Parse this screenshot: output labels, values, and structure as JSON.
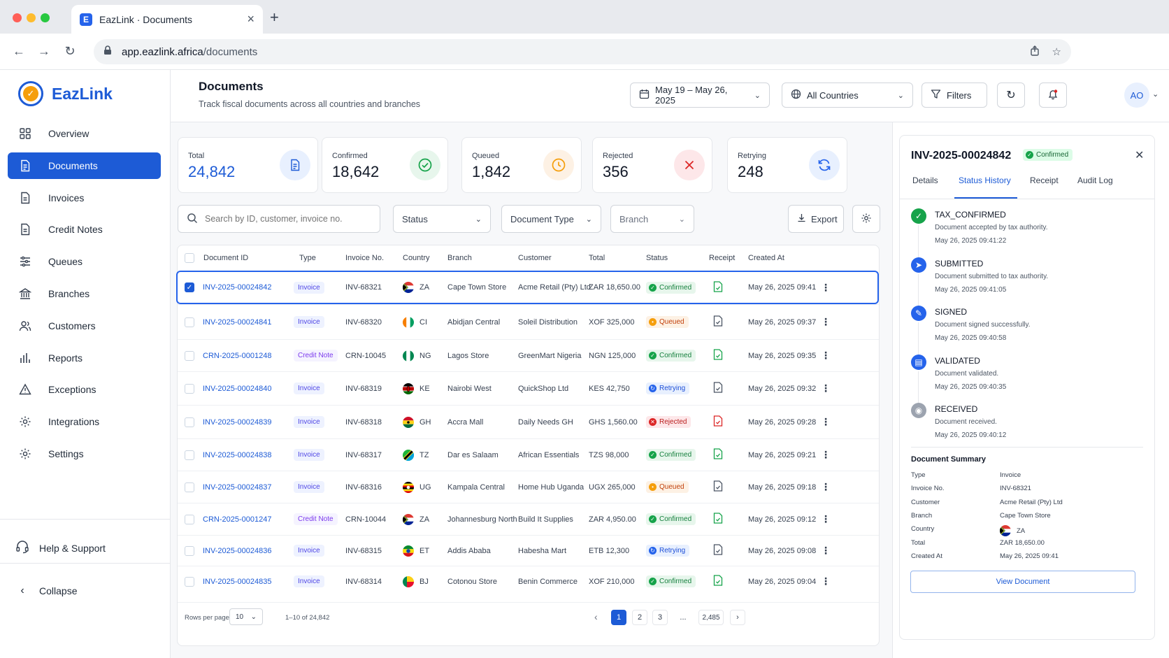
{
  "browser": {
    "tab_title": "EazLink · Documents",
    "favicon_letter": "E",
    "url_host": "app.eazlink.africa",
    "url_path": "/documents"
  },
  "brand": {
    "name": "EazLink",
    "accent": "#1d5bd6",
    "logo_color": "#f59e0b"
  },
  "sidebar": {
    "items": [
      {
        "label": "Overview",
        "icon": "grid-icon",
        "active": false
      },
      {
        "label": "Documents",
        "icon": "document-icon",
        "active": true
      },
      {
        "label": "Invoices",
        "icon": "invoice-icon",
        "active": false
      },
      {
        "label": "Credit Notes",
        "icon": "credit-note-icon",
        "active": false
      },
      {
        "label": "Queues",
        "icon": "queues-icon",
        "active": false
      },
      {
        "label": "Branches",
        "icon": "bank-icon",
        "active": false
      },
      {
        "label": "Customers",
        "icon": "users-icon",
        "active": false
      },
      {
        "label": "Reports",
        "icon": "bar-chart-icon",
        "active": false
      },
      {
        "label": "Exceptions",
        "icon": "warning-icon",
        "active": false
      },
      {
        "label": "Integrations",
        "icon": "integrations-gear-icon",
        "active": false
      },
      {
        "label": "Settings",
        "icon": "gear-icon",
        "active": false
      }
    ],
    "help_label": "Help & Support",
    "collapse_label": "Collapse"
  },
  "header": {
    "title": "Documents",
    "subtitle": "Track fiscal documents across all countries and branches",
    "date_range": "May 19 – May 26, 2025",
    "countries": "All Countries",
    "filters_label": "Filters",
    "avatar": "AO"
  },
  "stats": [
    {
      "label": "Total",
      "value": "24,842",
      "color": "#1d5bd6",
      "icon": "document-icon",
      "icon_bg": "#e8f0fe"
    },
    {
      "label": "Confirmed",
      "value": "18,642",
      "color": "#111827",
      "icon": "check-circle-icon",
      "icon_bg": "#e7f6ec"
    },
    {
      "label": "Queued",
      "value": "1,842",
      "color": "#111827",
      "icon": "clock-icon",
      "icon_bg": "#fdf1e4"
    },
    {
      "label": "Rejected",
      "value": "356",
      "color": "#111827",
      "icon": "x-icon",
      "icon_bg": "#fde7e9"
    },
    {
      "label": "Retrying",
      "value": "248",
      "color": "#111827",
      "icon": "refresh-icon",
      "icon_bg": "#e8f0fe"
    }
  ],
  "filters": {
    "search_placeholder": "Search by ID, customer, invoice no.",
    "status": "Status",
    "document_type": "Document Type",
    "branch": "Branch",
    "export": "Export"
  },
  "table": {
    "columns": [
      "Document ID",
      "Type",
      "Invoice No.",
      "Country",
      "Branch",
      "Customer",
      "Total",
      "Status",
      "Receipt",
      "Created At"
    ],
    "rows": [
      {
        "id": "INV-2025-00024842",
        "type": "Invoice",
        "invoice": "INV-68321",
        "country": "ZA",
        "branch": "Cape Town Store",
        "customer": "Acme Retail (Pty) Ltd",
        "total": "ZAR 18,650.00",
        "status": "Confirmed",
        "created": "May 26, 2025 09:41",
        "selected": true
      },
      {
        "id": "INV-2025-00024841",
        "type": "Invoice",
        "invoice": "INV-68320",
        "country": "CI",
        "branch": "Abidjan Central",
        "customer": "Soleil Distribution",
        "total": "XOF 325,000",
        "status": "Queued",
        "created": "May 26, 2025 09:37",
        "selected": false
      },
      {
        "id": "CRN-2025-0001248",
        "type": "Credit Note",
        "invoice": "CRN-10045",
        "country": "NG",
        "branch": "Lagos Store",
        "customer": "GreenMart Nigeria",
        "total": "NGN 125,000",
        "status": "Confirmed",
        "created": "May 26, 2025 09:35",
        "selected": false
      },
      {
        "id": "INV-2025-00024840",
        "type": "Invoice",
        "invoice": "INV-68319",
        "country": "KE",
        "branch": "Nairobi West",
        "customer": "QuickShop Ltd",
        "total": "KES 42,750",
        "status": "Retrying",
        "created": "May 26, 2025 09:32",
        "selected": false
      },
      {
        "id": "INV-2025-00024839",
        "type": "Invoice",
        "invoice": "INV-68318",
        "country": "GH",
        "branch": "Accra Mall",
        "customer": "Daily Needs GH",
        "total": "GHS 1,560.00",
        "status": "Rejected",
        "created": "May 26, 2025 09:28",
        "selected": false
      },
      {
        "id": "INV-2025-00024838",
        "type": "Invoice",
        "invoice": "INV-68317",
        "country": "TZ",
        "branch": "Dar es Salaam",
        "customer": "African Essentials",
        "total": "TZS 98,000",
        "status": "Confirmed",
        "created": "May 26, 2025 09:21",
        "selected": false
      },
      {
        "id": "INV-2025-00024837",
        "type": "Invoice",
        "invoice": "INV-68316",
        "country": "UG",
        "branch": "Kampala Central",
        "customer": "Home Hub Uganda",
        "total": "UGX 265,000",
        "status": "Queued",
        "created": "May 26, 2025 09:18",
        "selected": false
      },
      {
        "id": "CRN-2025-0001247",
        "type": "Credit Note",
        "invoice": "CRN-10044",
        "country": "ZA",
        "branch": "Johannesburg North",
        "customer": "Build It Supplies",
        "total": "ZAR 4,950.00",
        "status": "Confirmed",
        "created": "May 26, 2025 09:12",
        "selected": false
      },
      {
        "id": "INV-2025-00024836",
        "type": "Invoice",
        "invoice": "INV-68315",
        "country": "ET",
        "branch": "Addis Ababa",
        "customer": "Habesha Mart",
        "total": "ETB 12,300",
        "status": "Retrying",
        "created": "May 26, 2025 09:08",
        "selected": false
      },
      {
        "id": "INV-2025-00024835",
        "type": "Invoice",
        "invoice": "INV-68314",
        "country": "BJ",
        "branch": "Cotonou Store",
        "customer": "Benin Commerce",
        "total": "XOF 210,000",
        "status": "Confirmed",
        "created": "May 26, 2025 09:04",
        "selected": false
      }
    ],
    "rows_per_page_label": "Rows per page",
    "rows_per_page": "10",
    "range": "1–10 of 24,842",
    "pages": [
      "1",
      "2",
      "3",
      "...",
      "2,485"
    ]
  },
  "status_colors": {
    "Confirmed": {
      "bg": "#e7f6ec",
      "fg": "#15803d",
      "dot": "#16a34a",
      "glyph": "✓"
    },
    "Queued": {
      "bg": "#fdf1e4",
      "fg": "#c2410c",
      "dot": "#f59e0b",
      "glyph": "•"
    },
    "Retrying": {
      "bg": "#e8f0fe",
      "fg": "#1d4ed8",
      "dot": "#2563eb",
      "glyph": "↻"
    },
    "Rejected": {
      "bg": "#fde7e9",
      "fg": "#b91c1c",
      "dot": "#dc2626",
      "glyph": "✕"
    }
  },
  "panel": {
    "doc_id": "INV-2025-00024842",
    "status": "Confirmed",
    "tabs": [
      "Details",
      "Status History",
      "Receipt",
      "Audit Log"
    ],
    "active_tab": "Status History",
    "timeline": [
      {
        "title": "TAX_CONFIRMED",
        "desc": "Document accepted by tax authority.",
        "time": "May 26, 2025 09:41:22",
        "color": "#16a34a",
        "glyph": "✓"
      },
      {
        "title": "SUBMITTED",
        "desc": "Document submitted to tax authority.",
        "time": "May 26, 2025 09:41:05",
        "color": "#2563eb",
        "glyph": "➤"
      },
      {
        "title": "SIGNED",
        "desc": "Document signed successfully.",
        "time": "May 26, 2025 09:40:58",
        "color": "#2563eb",
        "glyph": "✎"
      },
      {
        "title": "VALIDATED",
        "desc": "Document validated.",
        "time": "May 26, 2025 09:40:35",
        "color": "#2563eb",
        "glyph": "▤"
      },
      {
        "title": "RECEIVED",
        "desc": "Document received.",
        "time": "May 26, 2025 09:40:12",
        "color": "#9ca3af",
        "glyph": "◉"
      }
    ],
    "summary_title": "Document Summary",
    "summary": [
      {
        "k": "Type",
        "v": "Invoice"
      },
      {
        "k": "Invoice No.",
        "v": "INV-68321"
      },
      {
        "k": "Customer",
        "v": "Acme Retail (Pty) Ltd"
      },
      {
        "k": "Branch",
        "v": "Cape Town Store"
      },
      {
        "k": "Country",
        "v": "ZA"
      },
      {
        "k": "Total",
        "v": "ZAR 18,650.00"
      },
      {
        "k": "Created At",
        "v": "May 26, 2025 09:41"
      }
    ],
    "view_button": "View Document"
  }
}
